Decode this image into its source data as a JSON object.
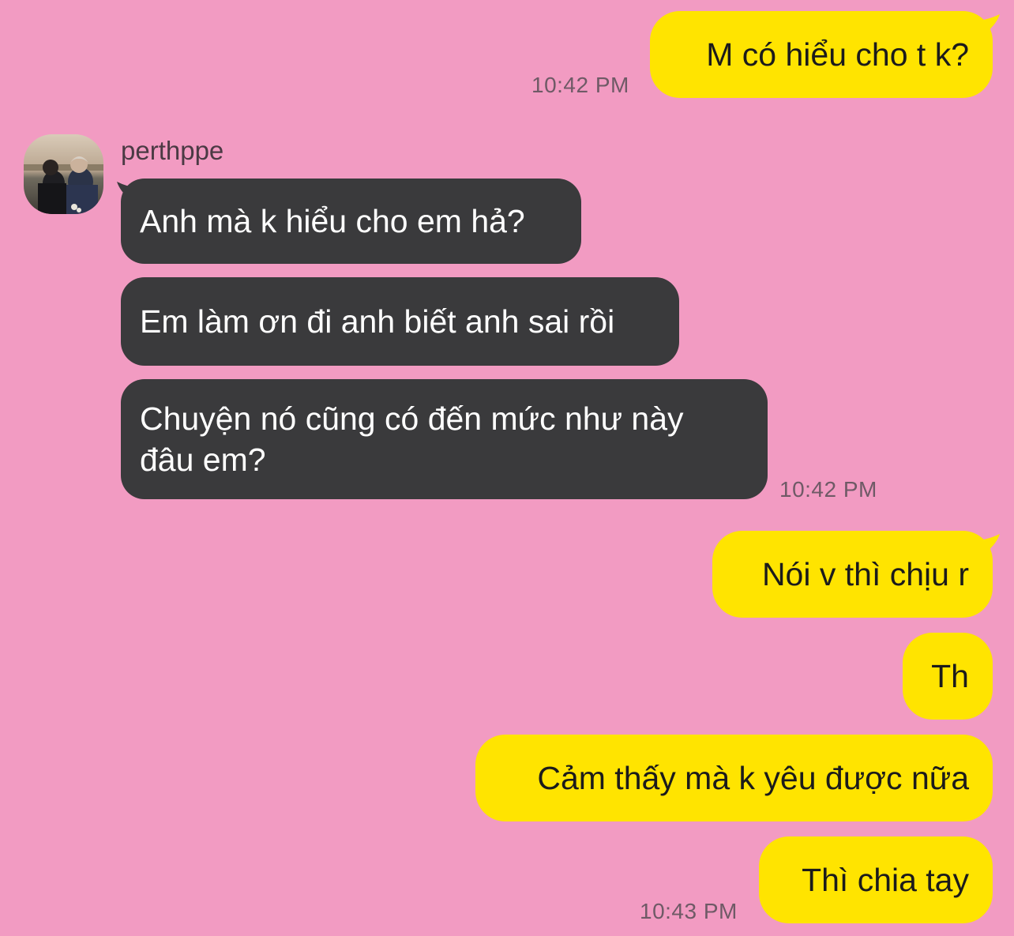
{
  "contact": {
    "name": "perthppe"
  },
  "messages": [
    {
      "text": "M có hiểu cho t k?"
    },
    {
      "text": "Anh mà k hiểu cho em hả?"
    },
    {
      "text": "Em làm ơn đi anh biết anh sai rồi"
    },
    {
      "text": "Chuyện nó cũng có đến mức như này đâu em?"
    },
    {
      "text": "Nói v thì chịu r"
    },
    {
      "text": "Th"
    },
    {
      "text": "Cảm thấy mà k yêu được nữa"
    },
    {
      "text": "Thì chia tay"
    }
  ],
  "timestamps": [
    "10:42 PM",
    "10:42 PM",
    "10:43 PM"
  ],
  "colors": {
    "background": "#f29bc2",
    "outgoing_bubble": "#ffe400",
    "incoming_bubble": "#3a3a3c"
  }
}
